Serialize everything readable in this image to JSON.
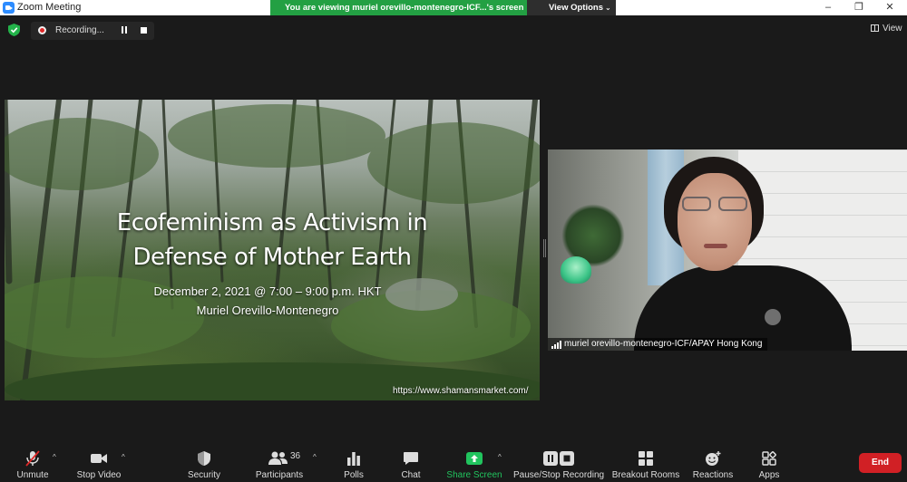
{
  "window": {
    "title": "Zoom Meeting",
    "controls": [
      "–",
      "❐",
      "✕"
    ]
  },
  "banner": {
    "viewing_text": "You are viewing muriel orevillo-montenegro-ICF...'s screen",
    "view_options_label": "View Options",
    "chevron": "⌄"
  },
  "top_bar": {
    "recording_label": "Recording...",
    "view_label": "View"
  },
  "slide": {
    "title_line1": "Ecofeminism as Activism in",
    "title_line2": "Defense of Mother Earth",
    "date_line": "December 2, 2021  @ 7:00 – 9:00 p.m. HKT",
    "author": "Muriel Orevillo-Montenegro",
    "url": "https://www.shamansmarket.com/"
  },
  "participant": {
    "name": "muriel orevillo-montenegro-ICF/APAY Hong Kong"
  },
  "toolbar": {
    "unmute": "Unmute",
    "stop_video": "Stop Video",
    "security": "Security",
    "participants": "Participants",
    "participants_count": "36",
    "polls": "Polls",
    "chat": "Chat",
    "share_screen": "Share Screen",
    "pause_stop_recording": "Pause/Stop Recording",
    "breakout_rooms": "Breakout Rooms",
    "reactions": "Reactions",
    "apps": "Apps",
    "end": "End",
    "caret": "^"
  },
  "colors": {
    "share_green": "#21c45e",
    "banner_green": "#23a043",
    "end_red": "#d12025",
    "recording_red": "#e02828"
  }
}
